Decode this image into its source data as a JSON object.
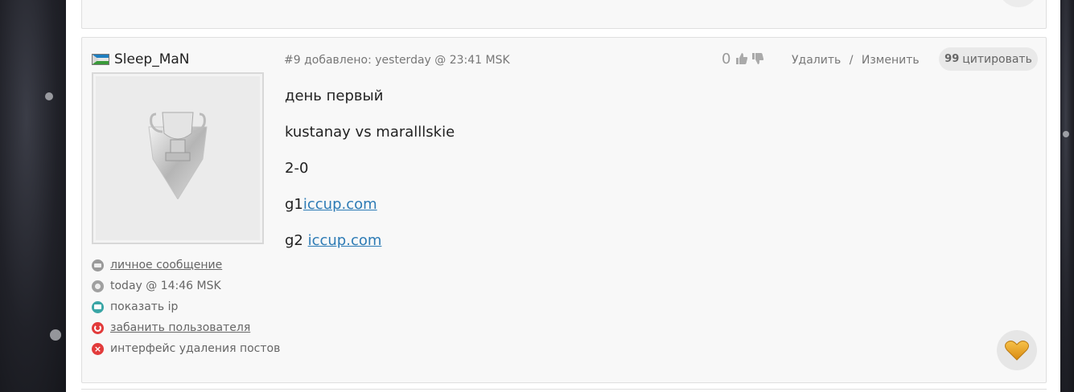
{
  "post": {
    "author": "Sleep_MaN",
    "number": "#9",
    "added_label": "добавлено:",
    "timestamp": "yesterday @ 23:41 MSK",
    "rating": "0",
    "delete_label": "Удалить",
    "separator": "/",
    "edit_label": "Изменить",
    "quote_label": "цитировать",
    "quote_mark": "99",
    "body": {
      "line1": "день первый",
      "line2": "kustanay vs maralllskie",
      "line3": "2-0",
      "g1_prefix": "g1",
      "g1_link": "iccup.com",
      "g2_prefix": "g2 ",
      "g2_link": "iccup.com"
    },
    "sidebar": {
      "private_message": "личное сообщение",
      "last_seen": "today @ 14:46 MSK",
      "show_ip": "показать ip",
      "ban_user": "забанить пользователя",
      "delete_posts": "интерфейс удаления постов"
    }
  },
  "colors": {
    "link": "#2d7bb5",
    "heart": "#e9a623",
    "ban_icon": "#e23b3b",
    "ip_icon": "#3aa6a6",
    "post_bg": "#f8f8f8"
  },
  "icons": [
    "flag-icon",
    "mail-icon",
    "clock-icon",
    "monitor-icon",
    "power-icon",
    "close-icon",
    "thumb-up-icon",
    "thumb-down-icon",
    "quote-icon",
    "heart-icon"
  ]
}
